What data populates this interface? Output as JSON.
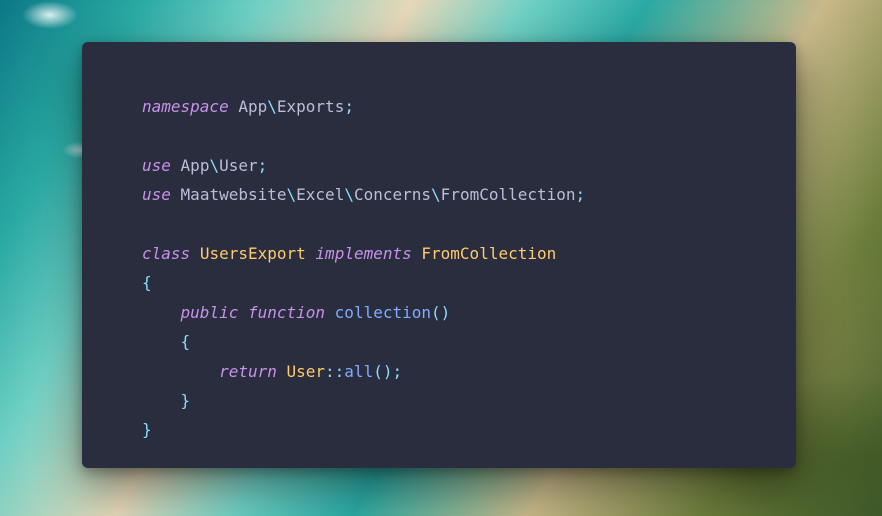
{
  "code": {
    "tokens": {
      "namespace_kw": "namespace",
      "ns_app": "App",
      "ns_exports": "Exports",
      "use_kw": "use",
      "ns_user": "User",
      "ns_maat": "Maatwebsite",
      "ns_excel": "Excel",
      "ns_concerns": "Concerns",
      "ns_fromcoll": "FromCollection",
      "class_kw": "class",
      "class_name": "UsersExport",
      "implements_kw": "implements",
      "iface_name": "FromCollection",
      "public_kw": "public",
      "function_kw": "function",
      "method_name": "collection",
      "return_kw": "return",
      "static_class": "User",
      "static_method": "all",
      "semi": ";",
      "bslash": "\\",
      "dcolon": "::",
      "lparen": "(",
      "rparen": ")",
      "lbrace": "{",
      "rbrace": "}",
      "sp": " "
    }
  }
}
